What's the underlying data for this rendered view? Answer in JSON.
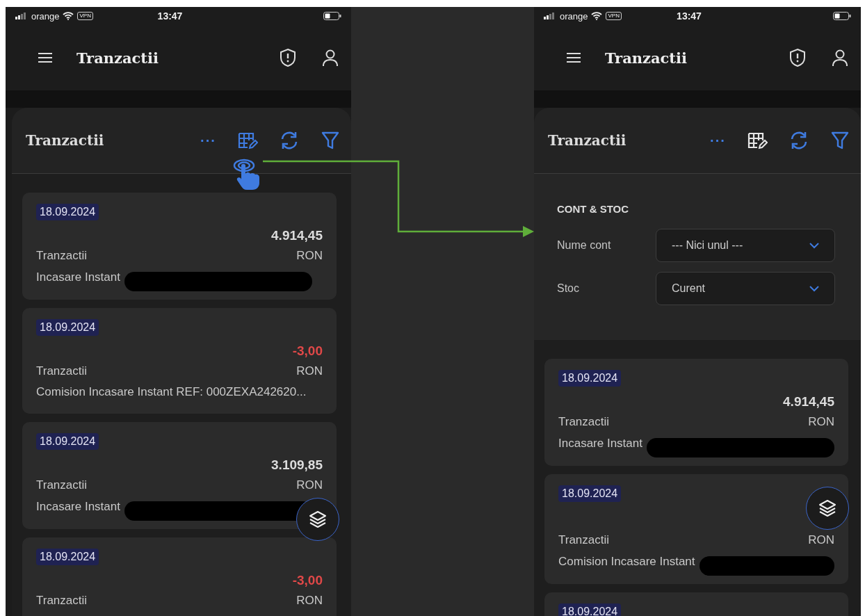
{
  "screens": [
    {
      "status_bar": {
        "carrier": "orange",
        "vpn": "VPN",
        "time": "13:47"
      },
      "app_bar": {
        "title": "Tranzactii"
      },
      "section": {
        "title": "Tranzactii",
        "more": "···"
      },
      "tap_hint": true,
      "transactions": [
        {
          "date": "18.09.2024",
          "amount": "4.914,45",
          "negative": false,
          "category": "Tranzactii",
          "currency": "RON",
          "description": "Incasare Instant",
          "redacted": true
        },
        {
          "date": "18.09.2024",
          "amount": "-3,00",
          "negative": true,
          "category": "Tranzactii",
          "currency": "RON",
          "description": "Comision Incasare Instant REF: 000ZEXA242620..."
        },
        {
          "date": "18.09.2024",
          "amount": "3.109,85",
          "negative": false,
          "category": "Tranzactii",
          "currency": "RON",
          "description": "Incasare Instant",
          "redacted": true
        },
        {
          "date": "18.09.2024",
          "amount": "-3,00",
          "negative": true,
          "category": "Tranzactii",
          "currency": "RON"
        }
      ]
    },
    {
      "status_bar": {
        "carrier": "orange",
        "vpn": "VPN",
        "time": "13:47"
      },
      "app_bar": {
        "title": "Tranzactii"
      },
      "section": {
        "title": "Tranzactii",
        "more": "···"
      },
      "filter_panel": {
        "heading": "CONT & STOC",
        "fields": [
          {
            "label": "Nume cont",
            "value": "--- Nici unul ---"
          },
          {
            "label": "Stoc",
            "value": "Curent"
          }
        ]
      },
      "transactions": [
        {
          "date": "18.09.2024",
          "amount": "4.914,45",
          "negative": false,
          "category": "Tranzactii",
          "currency": "RON",
          "description": "Incasare Instant",
          "redacted": true
        },
        {
          "date": "18.09.2024",
          "category": "Tranzactii",
          "currency": "RON",
          "description": "Comision Incasare Instant",
          "redacted": true
        },
        {
          "date": "18.09.2024"
        }
      ]
    }
  ]
}
